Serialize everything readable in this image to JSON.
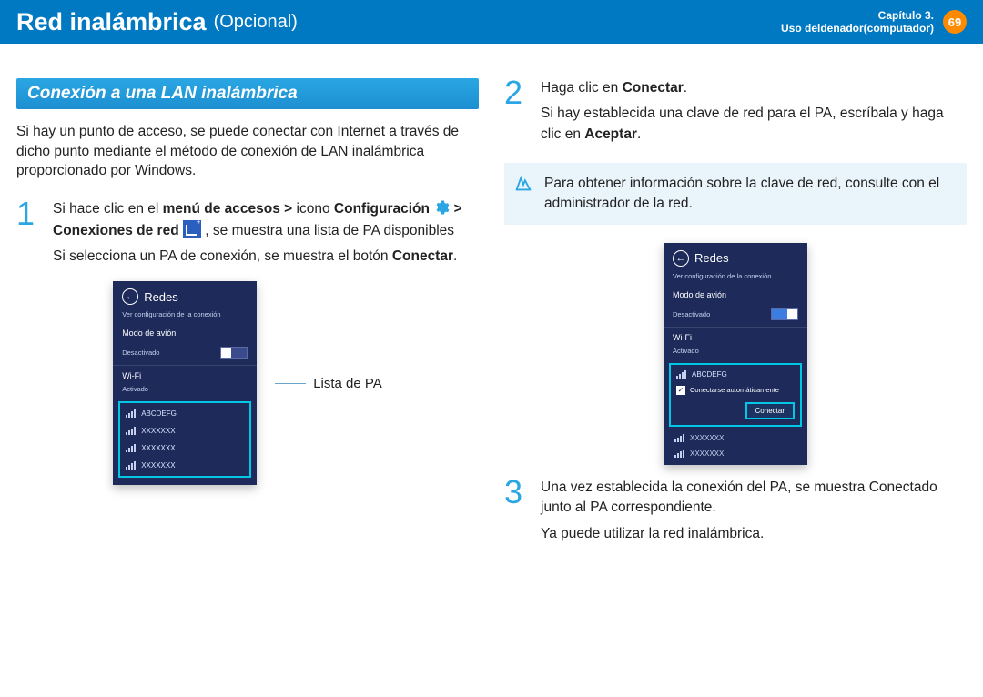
{
  "header": {
    "title": "Red inalámbrica",
    "optional": "(Opcional)",
    "chapter_line1": "Capítulo 3.",
    "chapter_line2": "Uso deldenador(computador)",
    "page": "69"
  },
  "left": {
    "section_title": "Conexión a una LAN inalámbrica",
    "intro": "Si hay un punto de acceso, se puede conectar con Internet a través de dicho punto mediante el método de conexión de LAN inalámbrica proporcionado por Windows.",
    "step1_a": "Si hace clic en el ",
    "step1_b": "menú de accesos > ",
    "step1_c": "icono ",
    "step1_d": "Configuración",
    "step1_e": " > ",
    "step1_f": "Conexiones de red",
    "step1_g": " , se muestra una lista de PA disponibles",
    "step1_line2": "Si selecciona un PA de conexión, se muestra el botón ",
    "step1_connect": "Conectar",
    "step1_dot": ".",
    "callout": "Lista de PA"
  },
  "right": {
    "step2_a": "Haga clic en ",
    "step2_b": "Conectar",
    "step2_c": ".",
    "step2_line2a": "Si hay establecida una clave de red para el PA, escríbala y haga clic en ",
    "step2_line2b": "Aceptar",
    "step2_line2c": ".",
    "note": "Para obtener información sobre la clave de red, consulte con el administrador de la red.",
    "step3_line1": "Una vez establecida la conexión del PA, se muestra Conectado junto al PA correspondiente.",
    "step3_line2": "Ya puede utilizar la red inalámbrica."
  },
  "shot": {
    "panel_title": "Redes",
    "view_config": "Ver configuración de la conexión",
    "airplane": "Modo de avión",
    "off": "Desactivado",
    "wifi": "Wi-Fi",
    "on": "Activado",
    "ap1": "ABCDEFG",
    "apx": "XXXXXXX",
    "auto_connect": "Conectarse automáticamente",
    "connect_btn": "Conectar"
  }
}
